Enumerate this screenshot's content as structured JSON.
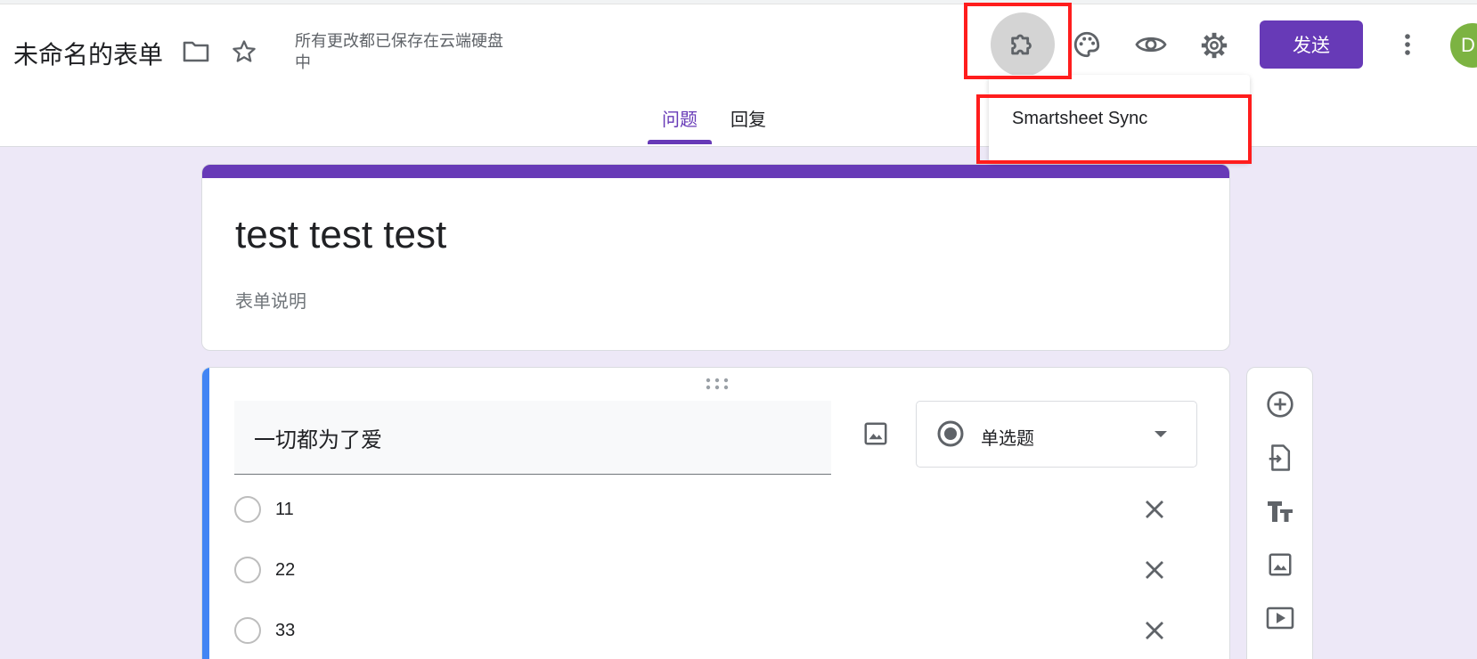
{
  "header": {
    "title": "未命名的表单",
    "save_status": "所有更改都已保存在云端硬盘中",
    "send_label": "发送",
    "avatar_initial": "D",
    "icons": [
      "folder-icon",
      "star-icon",
      "puzzle-icon",
      "palette-icon",
      "eye-icon",
      "gear-icon",
      "more-vert-icon"
    ]
  },
  "tabs": [
    {
      "label": "问题",
      "active": true
    },
    {
      "label": "回复",
      "active": false
    }
  ],
  "addon_menu": {
    "items": [
      {
        "label": "Smartsheet Sync"
      }
    ]
  },
  "form": {
    "title": "test test test",
    "description_placeholder": "表单说明"
  },
  "question": {
    "title": "一切都为了爱",
    "type_label": "单选题",
    "options": [
      {
        "label": "11"
      },
      {
        "label": "22"
      },
      {
        "label": "33"
      }
    ]
  },
  "floating_toolbar": {
    "icons": [
      "add-circle-icon",
      "import-icon",
      "title-text-icon",
      "image-icon",
      "video-icon"
    ]
  },
  "colors": {
    "accent": "#673ab7",
    "question_accent": "#4285f4",
    "background": "#ede8f7",
    "highlight_box": "#ff1d1d"
  }
}
